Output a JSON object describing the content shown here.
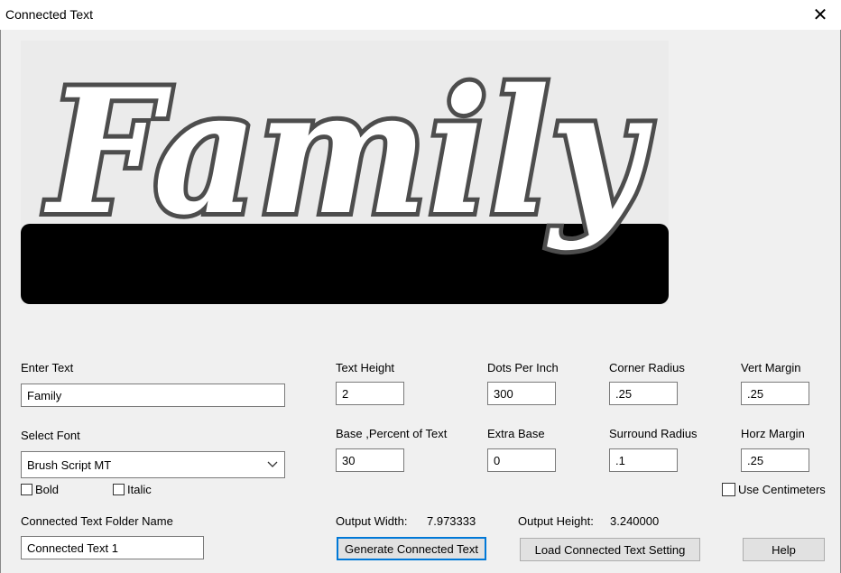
{
  "window": {
    "title": "Connected Text"
  },
  "preview": {
    "text": "Family"
  },
  "fields": {
    "enter_text": {
      "label": "Enter Text",
      "value": "Family"
    },
    "select_font": {
      "label": "Select Font",
      "value": "Brush Script MT"
    },
    "bold": {
      "label": "Bold",
      "checked": false
    },
    "italic": {
      "label": "Italic",
      "checked": false
    },
    "folder_name": {
      "label": "Connected Text Folder Name",
      "value": "Connected Text 1"
    },
    "text_height": {
      "label": "Text Height",
      "value": "2"
    },
    "dots_per_inch": {
      "label": "Dots Per Inch",
      "value": "300"
    },
    "corner_radius": {
      "label": "Corner Radius",
      "value": ".25"
    },
    "vert_margin": {
      "label": "Vert Margin",
      "value": ".25"
    },
    "base_percent": {
      "label": "Base ,Percent of Text",
      "value": "30"
    },
    "extra_base": {
      "label": "Extra Base",
      "value": "0"
    },
    "surround_radius": {
      "label": "Surround Radius",
      "value": ".1"
    },
    "horz_margin": {
      "label": "Horz Margin",
      "value": ".25"
    },
    "use_centimeters": {
      "label": "Use Centimeters",
      "checked": false
    }
  },
  "output": {
    "width_label": "Output Width:",
    "width_value": "7.973333",
    "height_label": "Output Height:",
    "height_value": "3.240000"
  },
  "buttons": {
    "generate": "Generate Connected Text",
    "load": "Load Connected Text Setting",
    "help": "Help"
  },
  "icons": {
    "close": "close-icon",
    "dropdown": "chevron-down-icon"
  }
}
